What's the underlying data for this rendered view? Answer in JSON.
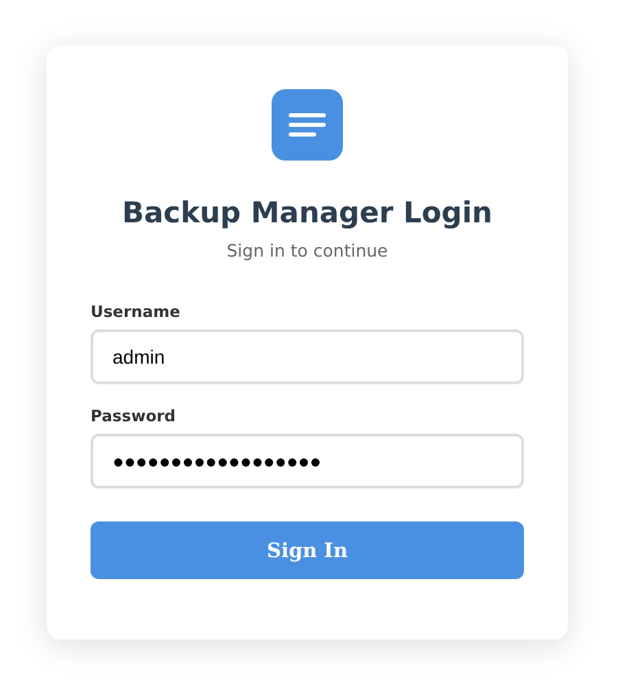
{
  "title": "Backup Manager Login",
  "subtitle": "Sign in to continue",
  "fields": [
    {
      "label": "Username",
      "value": "admin"
    },
    {
      "label": "Password",
      "value": "●●●●●●●●●●●●●●●●●●"
    }
  ],
  "buttons": [
    "Sign In"
  ]
}
